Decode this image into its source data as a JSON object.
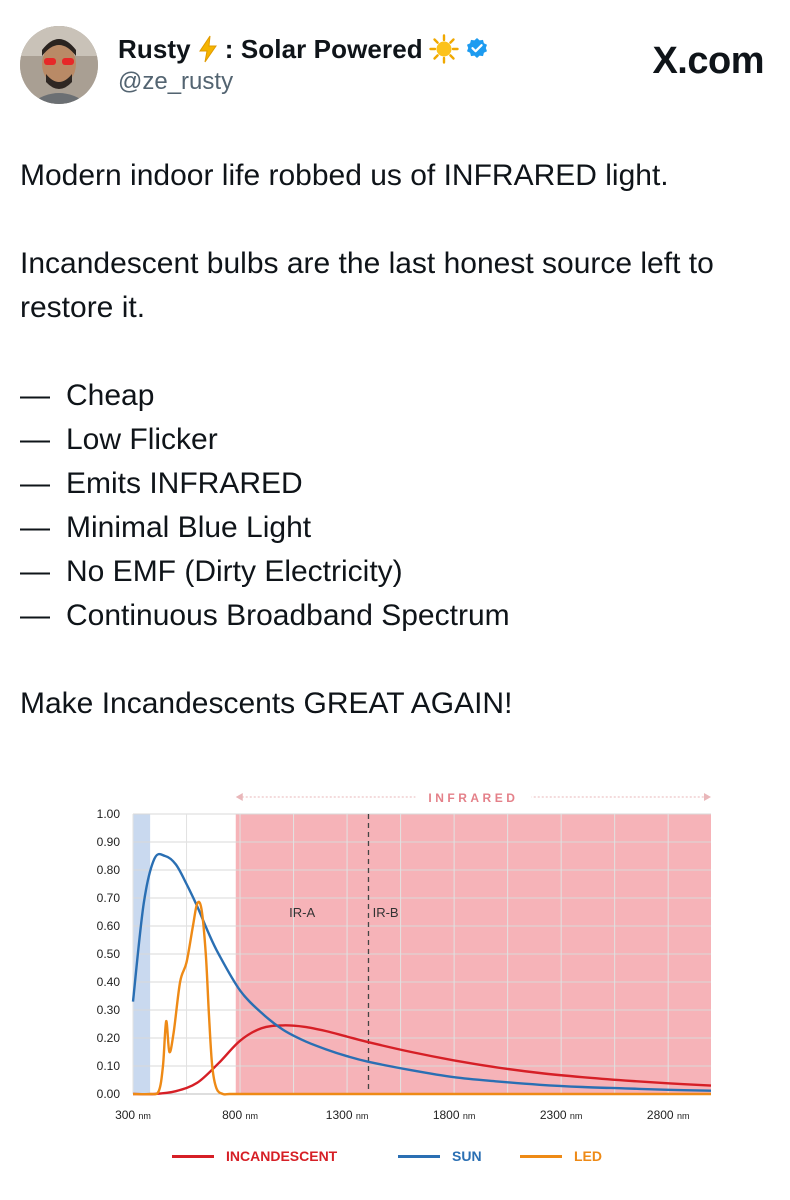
{
  "header": {
    "display_name": "Rusty",
    "name_separator": ": Solar Powered",
    "handle": "@ze_rusty",
    "brand": "X.com",
    "icons": [
      "lightning-icon",
      "sun-emoji-icon",
      "verified-badge-icon"
    ],
    "colors": {
      "verified": "#1d9bf0",
      "handle": "#536471",
      "lightning": "#f5b400"
    }
  },
  "post": {
    "line1": "Modern indoor life robbed us of INFRARED light.",
    "line2": "Incandescent bulbs are the last honest source left to restore it.",
    "dash": "—",
    "bullets": [
      "Cheap",
      "Low Flicker",
      "Emits INFRARED",
      "Minimal Blue Light",
      "No EMF (Dirty Electricity)",
      "Continuous Broadband Spectrum"
    ],
    "closing": "Make Incandescents GREAT AGAIN!"
  },
  "chart_data": {
    "type": "line",
    "title": "",
    "xlabel": "",
    "ylabel": "",
    "xlim": [
      300,
      3000
    ],
    "ylim": [
      0,
      1.0
    ],
    "x_ticks": [
      300,
      800,
      1300,
      1800,
      2300,
      2800
    ],
    "x_tick_unit": "nm",
    "y_ticks": [
      "0.00",
      "0.10",
      "0.20",
      "0.30",
      "0.40",
      "0.50",
      "0.60",
      "0.70",
      "0.80",
      "0.90",
      "1.00"
    ],
    "grid": true,
    "bands": [
      {
        "label": "",
        "from": 300,
        "to": 380,
        "color": "#c9d9ef"
      },
      {
        "label": "INFRARED",
        "from": 780,
        "to": 3000,
        "color": "#f6b3b8"
      }
    ],
    "annotations": [
      {
        "text": "IR-A",
        "x": 1090,
        "y": 0.65
      },
      {
        "text": "IR-B",
        "x": 1480,
        "y": 0.65
      }
    ],
    "ir_divider_x": 1400,
    "legend_position": "bottom",
    "series": [
      {
        "name": "INCANDESCENT",
        "color": "#d61f26",
        "x": [
          300,
          400,
          500,
          600,
          700,
          800,
          900,
          1000,
          1100,
          1200,
          1300,
          1400,
          1600,
          1800,
          2000,
          2200,
          2400,
          2600,
          2800,
          3000
        ],
        "y": [
          0,
          0,
          0.01,
          0.04,
          0.11,
          0.19,
          0.235,
          0.245,
          0.24,
          0.225,
          0.205,
          0.185,
          0.15,
          0.12,
          0.095,
          0.075,
          0.06,
          0.048,
          0.038,
          0.03
        ]
      },
      {
        "name": "SUN",
        "color": "#2a6fb3",
        "x": [
          300,
          350,
          400,
          450,
          500,
          550,
          600,
          650,
          700,
          800,
          900,
          1000,
          1100,
          1200,
          1300,
          1400,
          1600,
          1800,
          2000,
          2200,
          2400,
          2600,
          2800,
          3000
        ],
        "y": [
          0.33,
          0.68,
          0.84,
          0.85,
          0.82,
          0.75,
          0.67,
          0.58,
          0.5,
          0.37,
          0.29,
          0.23,
          0.19,
          0.16,
          0.135,
          0.115,
          0.085,
          0.06,
          0.045,
          0.033,
          0.025,
          0.02,
          0.015,
          0.012
        ]
      },
      {
        "name": "LED",
        "color": "#ee8a16",
        "x": [
          300,
          380,
          420,
          440,
          455,
          470,
          490,
          520,
          550,
          580,
          600,
          620,
          640,
          655,
          670,
          690,
          720,
          750,
          800,
          1000,
          1500,
          2000,
          2500,
          3000
        ],
        "y": [
          0,
          0,
          0.01,
          0.1,
          0.26,
          0.15,
          0.22,
          0.4,
          0.47,
          0.6,
          0.68,
          0.66,
          0.5,
          0.28,
          0.1,
          0.02,
          0,
          0,
          0,
          0,
          0,
          0,
          0,
          0
        ]
      }
    ]
  }
}
